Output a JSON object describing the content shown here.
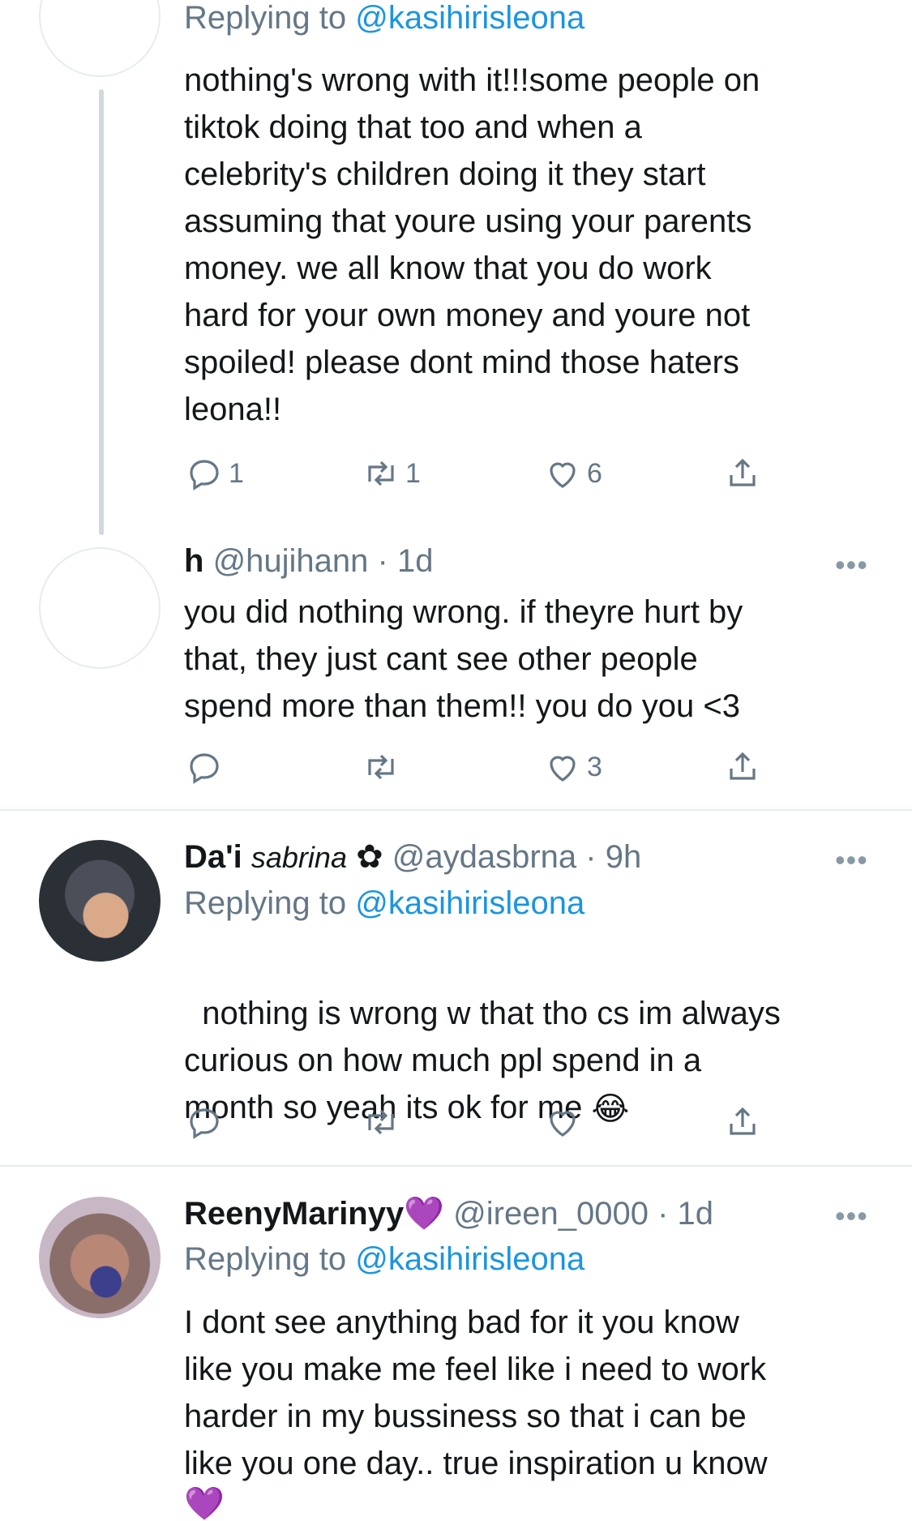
{
  "tweets": [
    {
      "replying_prefix": "Replying to ",
      "replying_handle": "@kasihirisleona",
      "text": "nothing's wrong with it!!!some people on\ntiktok doing that too and when a\ncelebrity's children doing it they start\nassuming that youre using your parents\nmoney. we all know that you do work\nhard for your own money and youre not\nspoiled! please dont mind those haters\nleona!!",
      "reply_count": "1",
      "retweet_count": "1",
      "like_count": "6"
    },
    {
      "name": "h",
      "handle": "@hujihann",
      "time": "· 1d",
      "more": "•••",
      "text": "you did nothing wrong. if theyre hurt by\nthat, they just cant see other people\nspend more than them!! you do you <3",
      "reply_count": "",
      "retweet_count": "",
      "like_count": "3"
    },
    {
      "name": "Da'i",
      "name_italic": "sabrina",
      "name_emoji": "✿",
      "handle": "@aydasbrna",
      "time": "· 9h",
      "more": "•••",
      "replying_prefix": "Replying to ",
      "replying_handle": "@kasihirisleona",
      "text": "nothing is wrong w that tho cs im always\ncurious on how much ppl spend in a\nmonth so yeah its ok for me",
      "text_emoji": "😂",
      "reply_count": "",
      "retweet_count": "",
      "like_count": ""
    },
    {
      "name": "ReenyMarinyy",
      "name_emoji": "💜",
      "handle": "@ireen_0000",
      "time": "· 1d",
      "more": "•••",
      "replying_prefix": "Replying to ",
      "replying_handle": "@kasihirisleona",
      "text": "I dont see anything bad for it you know\nlike you make me feel like i need to work\nharder in my bussiness so that i can be\nlike you one day.. true inspiration u know",
      "text_emoji": "💜"
    }
  ],
  "colors": {
    "link": "#1b95e0",
    "muted": "#657786",
    "text": "#14171a",
    "divider": "#e6ecf0"
  },
  "icons": {
    "reply": "reply-icon",
    "retweet": "retweet-icon",
    "like": "heart-icon",
    "share": "share-icon",
    "more": "more-icon"
  }
}
